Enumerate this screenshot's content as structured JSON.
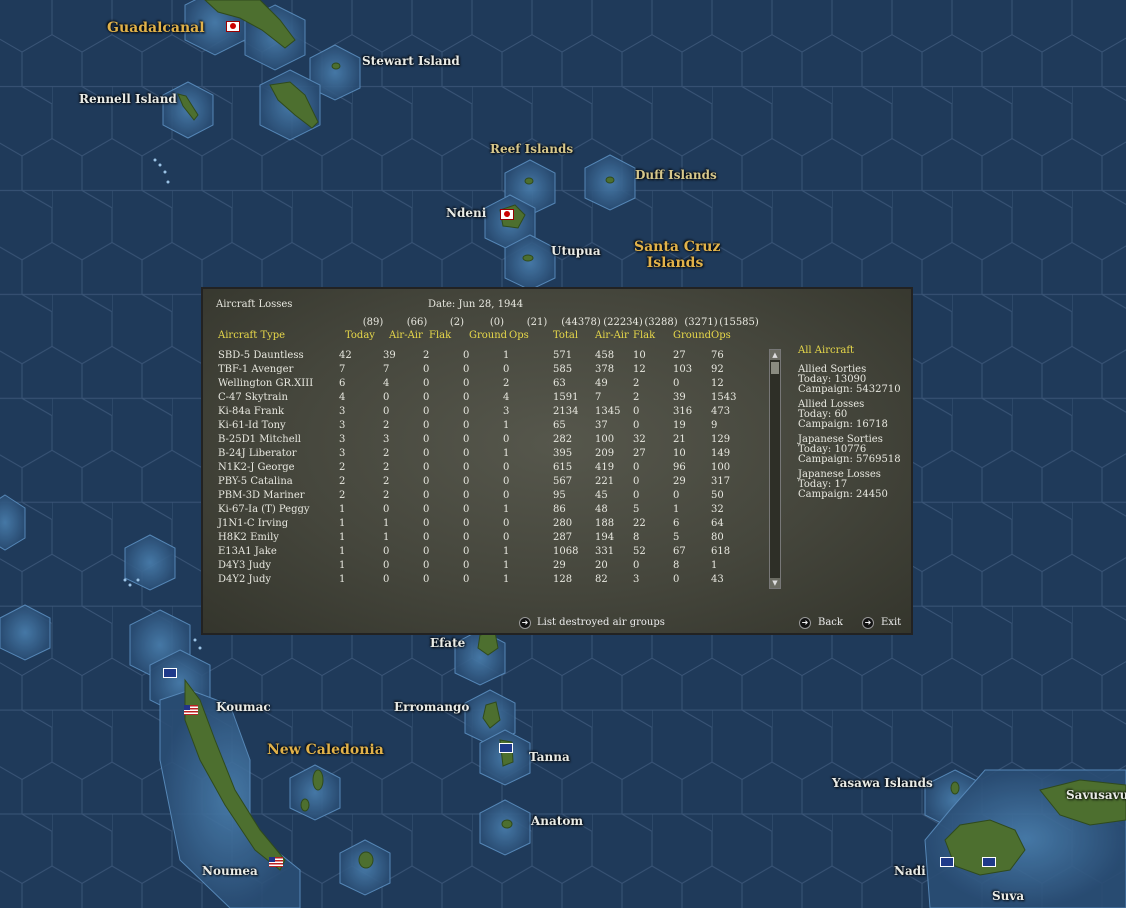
{
  "map": {
    "labels": {
      "guadalcanal": "Guadalcanal",
      "stewart": "Stewart Island",
      "rennell": "Rennell Island",
      "reef": "Reef Islands",
      "duff": "Duff Islands",
      "ndeni": "Ndeni",
      "utupua": "Utupua",
      "santa_cruz_1": "Santa Cruz",
      "santa_cruz_2": "Islands",
      "efate": "Efate",
      "koumac": "Koumac",
      "erromango": "Erromango",
      "new_caledonia": "New Caledonia",
      "tanna": "Tanna",
      "anatom": "Anatom",
      "yasawa": "Yasawa Islands",
      "savusavu": "Savusavu",
      "noumea": "Noumea",
      "nadi": "Nadi",
      "suva": "Suva"
    },
    "colors": {
      "ocean": "#1f3a5a",
      "shallow": "#3d6e9c",
      "land": "#4a6d2c"
    }
  },
  "panel": {
    "title": "Aircraft Losses",
    "date": "Date: Jun 28, 1944",
    "headers": {
      "aircraft_type": "Aircraft Type",
      "today_totals": [
        "(89)",
        "(66)",
        "(2)",
        "(0)",
        "(21)"
      ],
      "today_labels": [
        "Today",
        "Air-Air",
        "Flak",
        "Ground",
        "Ops"
      ],
      "total_totals": [
        "(44378)",
        "(22234)",
        "(3288)",
        "(3271)",
        "(15585)"
      ],
      "total_labels": [
        "Total",
        "Air-Air",
        "Flak",
        "Ground",
        "Ops"
      ]
    },
    "rows": [
      {
        "name": "SBD-5 Dauntless",
        "v": [
          "42",
          "39",
          "2",
          "0",
          "1",
          "571",
          "458",
          "10",
          "27",
          "76"
        ]
      },
      {
        "name": "TBF-1 Avenger",
        "v": [
          "7",
          "7",
          "0",
          "0",
          "0",
          "585",
          "378",
          "12",
          "103",
          "92"
        ]
      },
      {
        "name": "Wellington GR.XIII",
        "v": [
          "6",
          "4",
          "0",
          "0",
          "2",
          "63",
          "49",
          "2",
          "0",
          "12"
        ]
      },
      {
        "name": "C-47 Skytrain",
        "v": [
          "4",
          "0",
          "0",
          "0",
          "4",
          "1591",
          "7",
          "2",
          "39",
          "1543"
        ]
      },
      {
        "name": "Ki-84a Frank",
        "v": [
          "3",
          "0",
          "0",
          "0",
          "3",
          "2134",
          "1345",
          "0",
          "316",
          "473"
        ]
      },
      {
        "name": "Ki-61-Id Tony",
        "v": [
          "3",
          "2",
          "0",
          "0",
          "1",
          "65",
          "37",
          "0",
          "19",
          "9"
        ]
      },
      {
        "name": "B-25D1 Mitchell",
        "v": [
          "3",
          "3",
          "0",
          "0",
          "0",
          "282",
          "100",
          "32",
          "21",
          "129"
        ]
      },
      {
        "name": "B-24J Liberator",
        "v": [
          "3",
          "2",
          "0",
          "0",
          "1",
          "395",
          "209",
          "27",
          "10",
          "149"
        ]
      },
      {
        "name": "N1K2-J George",
        "v": [
          "2",
          "2",
          "0",
          "0",
          "0",
          "615",
          "419",
          "0",
          "96",
          "100"
        ]
      },
      {
        "name": "PBY-5 Catalina",
        "v": [
          "2",
          "2",
          "0",
          "0",
          "0",
          "567",
          "221",
          "0",
          "29",
          "317"
        ]
      },
      {
        "name": "PBM-3D Mariner",
        "v": [
          "2",
          "2",
          "0",
          "0",
          "0",
          "95",
          "45",
          "0",
          "0",
          "50"
        ]
      },
      {
        "name": "Ki-67-Ia (T) Peggy",
        "v": [
          "1",
          "0",
          "0",
          "0",
          "1",
          "86",
          "48",
          "5",
          "1",
          "32"
        ]
      },
      {
        "name": "J1N1-C Irving",
        "v": [
          "1",
          "1",
          "0",
          "0",
          "0",
          "280",
          "188",
          "22",
          "6",
          "64"
        ]
      },
      {
        "name": "H8K2 Emily",
        "v": [
          "1",
          "1",
          "0",
          "0",
          "0",
          "287",
          "194",
          "8",
          "5",
          "80"
        ]
      },
      {
        "name": "E13A1 Jake",
        "v": [
          "1",
          "0",
          "0",
          "0",
          "1",
          "1068",
          "331",
          "52",
          "67",
          "618"
        ]
      },
      {
        "name": "D4Y3 Judy",
        "v": [
          "1",
          "0",
          "0",
          "0",
          "1",
          "29",
          "20",
          "0",
          "8",
          "1"
        ]
      },
      {
        "name": "D4Y2 Judy",
        "v": [
          "1",
          "0",
          "0",
          "0",
          "1",
          "128",
          "82",
          "3",
          "0",
          "43"
        ]
      }
    ],
    "summary": {
      "all_aircraft": "All Aircraft",
      "allied_sorties": {
        "title": "Allied Sorties",
        "today": "Today:   13090",
        "campaign": "Campaign: 5432710"
      },
      "allied_losses": {
        "title": "Allied Losses",
        "today": "Today:   60",
        "campaign": "Campaign: 16718"
      },
      "japanese_sorties": {
        "title": "Japanese Sorties",
        "today": "Today:   10776",
        "campaign": "Campaign: 5769518"
      },
      "japanese_losses": {
        "title": "Japanese Losses",
        "today": "Today:   17",
        "campaign": "Campaign: 24450"
      }
    },
    "buttons": {
      "list_destroyed": "List destroyed air groups",
      "back": "Back",
      "exit": "Exit"
    }
  }
}
